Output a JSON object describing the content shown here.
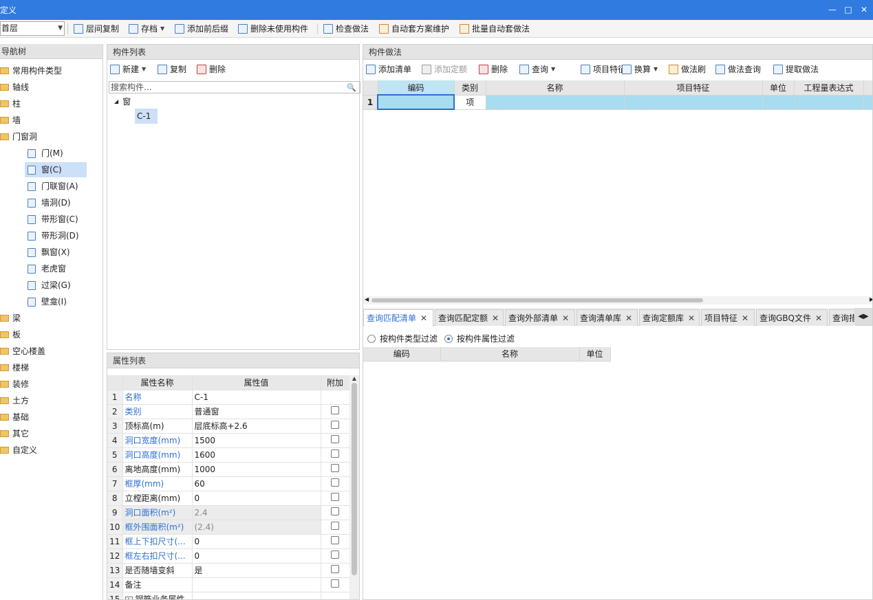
{
  "window": {
    "title": "定义",
    "minimize": "—",
    "maximize": "□",
    "close": "✕"
  },
  "toolbar": {
    "floor": "首层",
    "buttons": [
      "层间复制",
      "存档",
      "添加前后缀",
      "删除未使用构件",
      "检查做法",
      "自动套方案维护",
      "批量自动套做法"
    ]
  },
  "nav": {
    "title": "导航树",
    "items": [
      {
        "label": "常用构件类型",
        "type": "folder"
      },
      {
        "label": "轴线",
        "type": "folder"
      },
      {
        "label": "柱",
        "type": "folder"
      },
      {
        "label": "墙",
        "type": "folder"
      },
      {
        "label": "门窗洞",
        "type": "folder-open"
      },
      {
        "label": "门(M)",
        "type": "sub",
        "icon": "door-icon"
      },
      {
        "label": "窗(C)",
        "type": "sub",
        "icon": "window-icon",
        "selected": true
      },
      {
        "label": "门联窗(A)",
        "type": "sub",
        "icon": "door-window-icon"
      },
      {
        "label": "墙洞(D)",
        "type": "sub",
        "icon": "wall-opening-icon"
      },
      {
        "label": "带形窗(C)",
        "type": "sub",
        "icon": "strip-window-icon"
      },
      {
        "label": "带形洞(D)",
        "type": "sub",
        "icon": "strip-opening-icon"
      },
      {
        "label": "飘窗(X)",
        "type": "sub",
        "icon": "bay-window-icon"
      },
      {
        "label": "老虎窗",
        "type": "sub",
        "icon": "dormer-icon"
      },
      {
        "label": "过梁(G)",
        "type": "sub",
        "icon": "lintel-icon"
      },
      {
        "label": "壁龛(I)",
        "type": "sub",
        "icon": "niche-icon"
      },
      {
        "label": "梁",
        "type": "folder"
      },
      {
        "label": "板",
        "type": "folder"
      },
      {
        "label": "空心楼盖",
        "type": "folder"
      },
      {
        "label": "楼梯",
        "type": "folder"
      },
      {
        "label": "装修",
        "type": "folder"
      },
      {
        "label": "土方",
        "type": "folder"
      },
      {
        "label": "基础",
        "type": "folder"
      },
      {
        "label": "其它",
        "type": "folder"
      },
      {
        "label": "自定义",
        "type": "folder"
      }
    ]
  },
  "component_list": {
    "title": "构件列表",
    "new": "新建",
    "copy": "复制",
    "delete": "删除",
    "search_placeholder": "搜索构件...",
    "tree_root": "窗",
    "tree_child": "C-1"
  },
  "properties": {
    "title": "属性列表",
    "headers": [
      "属性名称",
      "属性值",
      "附加"
    ],
    "rows": [
      {
        "n": "1",
        "name": "名称",
        "value": "C-1",
        "blue": true,
        "cb": false
      },
      {
        "n": "2",
        "name": "类别",
        "value": "普通窗",
        "blue": true,
        "cb": true
      },
      {
        "n": "3",
        "name": "顶标高(m)",
        "value": "层底标高+2.6",
        "blue": false,
        "cb": true
      },
      {
        "n": "4",
        "name": "洞口宽度(mm)",
        "value": "1500",
        "blue": true,
        "cb": true
      },
      {
        "n": "5",
        "name": "洞口高度(mm)",
        "value": "1600",
        "blue": true,
        "cb": true
      },
      {
        "n": "6",
        "name": "离地高度(mm)",
        "value": "1000",
        "blue": false,
        "cb": true
      },
      {
        "n": "7",
        "name": "框厚(mm)",
        "value": "60",
        "blue": true,
        "cb": true
      },
      {
        "n": "8",
        "name": "立樘距离(mm)",
        "value": "0",
        "blue": false,
        "cb": true
      },
      {
        "n": "9",
        "name": "洞口面积(m²)",
        "value": "2.4",
        "blue": true,
        "cb": true,
        "gray": true
      },
      {
        "n": "10",
        "name": "框外围面积(m²)",
        "value": "(2.4)",
        "blue": true,
        "cb": true,
        "gray": true
      },
      {
        "n": "11",
        "name": "框上下扣尺寸(...",
        "value": "0",
        "blue": true,
        "cb": true
      },
      {
        "n": "12",
        "name": "框左右扣尺寸(...",
        "value": "0",
        "blue": true,
        "cb": true
      },
      {
        "n": "13",
        "name": "是否随墙变斜",
        "value": "是",
        "blue": false,
        "cb": true
      },
      {
        "n": "14",
        "name": "备注",
        "value": "",
        "blue": false,
        "cb": true
      },
      {
        "n": "15",
        "name": "钢筋业务属性",
        "value": "",
        "blue": false,
        "cb": false,
        "expander": "+"
      }
    ]
  },
  "method": {
    "title": "构件做法",
    "buttons": [
      "添加清单",
      "添加定额",
      "删除",
      "查询",
      "项目特征",
      "换算",
      "做法刷",
      "做法查询",
      "提取做法"
    ],
    "headers": [
      "编码",
      "类别",
      "名称",
      "项目特征",
      "单位",
      "工程量表达式"
    ],
    "row": {
      "n": "1",
      "type": "项"
    }
  },
  "tabs": [
    "查询匹配清单",
    "查询匹配定额",
    "查询外部清单",
    "查询清单库",
    "查询定额库",
    "项目特征",
    "查询GBQ文件",
    "查询措"
  ],
  "filters": {
    "by_type": "按构件类型过滤",
    "by_attr": "按构件属性过滤"
  },
  "result_headers": [
    "编码",
    "名称",
    "单位"
  ]
}
